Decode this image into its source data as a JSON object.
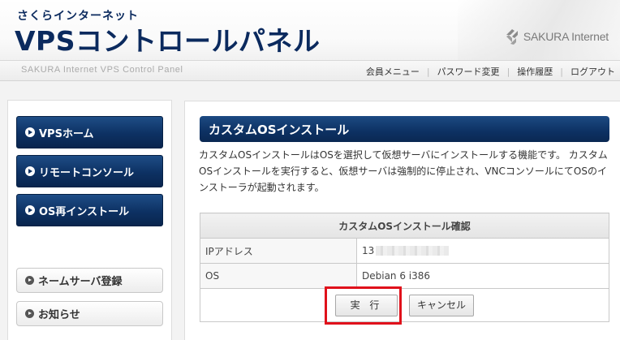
{
  "header": {
    "brand_small": "さくらインターネット",
    "brand_title": "VPSコントロールパネル",
    "logo_text": "SAKURA Internet",
    "tagline": "SAKURA Internet VPS Control Panel"
  },
  "topnav": {
    "items": [
      "会員メニュー",
      "パスワード変更",
      "操作履歴",
      "ログアウト"
    ]
  },
  "sidebar": {
    "primary": [
      "VPSホーム",
      "リモートコンソール",
      "OS再インストール"
    ],
    "secondary": [
      "ネームサーバ登録",
      "お知らせ"
    ]
  },
  "main": {
    "title": "カスタムOSインストール",
    "description": "カスタムOSインストールはOSを選択して仮想サーバにインストールする機能です。 カスタムOSインストールを実行すると、仮想サーバは強制的に停止され、VNCコンソールにてOSのインストーラが起動されます。",
    "table": {
      "header": "カスタムOSインストール確認",
      "rows": [
        {
          "label": "IPアドレス",
          "value": "13"
        },
        {
          "label": "OS",
          "value": "Debian 6 i386"
        }
      ]
    },
    "buttons": {
      "execute": "実 行",
      "cancel": "キャンセル"
    }
  },
  "colors": {
    "navy": "#0d3163",
    "highlight": "#e0111b"
  }
}
